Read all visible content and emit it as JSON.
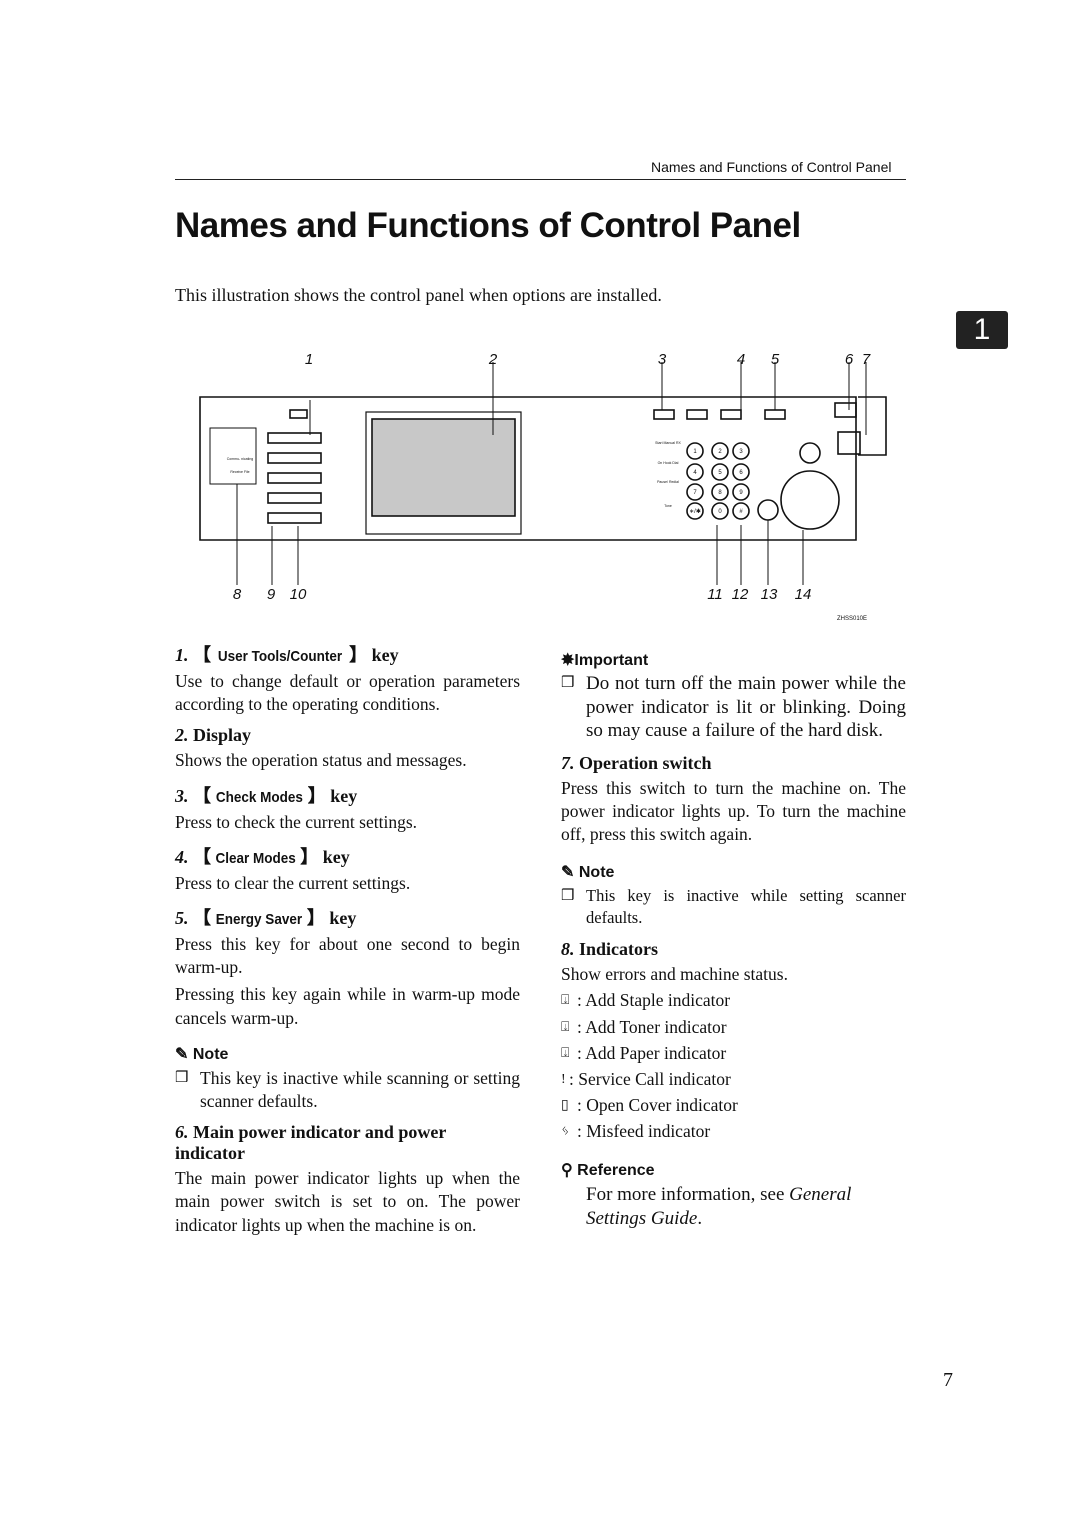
{
  "running_header": "Names and Functions of Control Panel",
  "title": "Names and Functions of Control Panel",
  "intro": "This illustration shows the control panel when options are installed.",
  "chapter_tab": "1",
  "figure": {
    "callouts_top": [
      "1",
      "2",
      "3",
      "4",
      "5",
      "6",
      "7"
    ],
    "callouts_bottom": [
      "8",
      "9",
      "10",
      "11",
      "12",
      "13",
      "14"
    ],
    "figure_id": "ZHSS010E",
    "keypad": [
      "1",
      "2",
      "3",
      "4",
      "5",
      "6",
      "7",
      "8",
      "9",
      "∗/✱",
      "0",
      "#"
    ],
    "side_keys": [
      "Start Manual RX",
      "On Hook Dial",
      "Pause/ Redial",
      "Tone"
    ],
    "indicator_labels": [
      "Commu- nicating",
      "Receive File"
    ]
  },
  "left": {
    "s1": {
      "num": "1.",
      "key": "User Tools/Counter",
      "suffix": "key",
      "body": "Use to change default or operation parameters according to the operating conditions."
    },
    "s2": {
      "num": "2.",
      "label": "Display",
      "body": "Shows the operation status and messages."
    },
    "s3": {
      "num": "3.",
      "key": "Check Modes",
      "suffix": "key",
      "body": "Press to check the current settings."
    },
    "s4": {
      "num": "4.",
      "key": "Clear Modes",
      "suffix": "key",
      "body": "Press to clear the current settings."
    },
    "s5": {
      "num": "5.",
      "key": "Energy Saver",
      "suffix": "key",
      "body1": "Press this key for about one second to begin warm-up.",
      "body2": "Pressing this key again while in warm-up mode cancels warm-up."
    },
    "note": {
      "label": "Note",
      "item": "This key is inactive while scanning or setting scanner defaults."
    },
    "s6": {
      "num": "6.",
      "label": "Main power indicator and power indicator",
      "body": "The main power indicator lights up when the main power switch is set to on. The power indicator lights up when the machine is on."
    }
  },
  "right": {
    "important": {
      "label": "Important",
      "item": "Do not turn off the main power while the power indicator is lit or blinking. Doing so may cause a failure of the hard disk."
    },
    "s7": {
      "num": "7.",
      "label": "Operation switch",
      "body": "Press this switch to turn the machine on. The power indicator lights up. To turn the machine off, press this switch again."
    },
    "note": {
      "label": "Note",
      "item": "This key is inactive while setting scanner defaults."
    },
    "s8": {
      "num": "8.",
      "label": "Indicators",
      "body": "Show errors and machine status.",
      "indicators": [
        {
          "icon": "add-staple-icon",
          "text": ": Add Staple indicator"
        },
        {
          "icon": "add-toner-icon",
          "text": ": Add Toner indicator"
        },
        {
          "icon": "add-paper-icon",
          "text": ": Add Paper indicator"
        },
        {
          "icon": "service-call-icon",
          "text": ": Service Call indicator"
        },
        {
          "icon": "open-cover-icon",
          "text": ": Open Cover indicator"
        },
        {
          "icon": "misfeed-icon",
          "text": ": Misfeed indicator"
        }
      ]
    },
    "reference": {
      "label": "Reference",
      "text": "For more information, see ",
      "italic": "General Settings Guide",
      "end": "."
    }
  },
  "page_number": "7"
}
